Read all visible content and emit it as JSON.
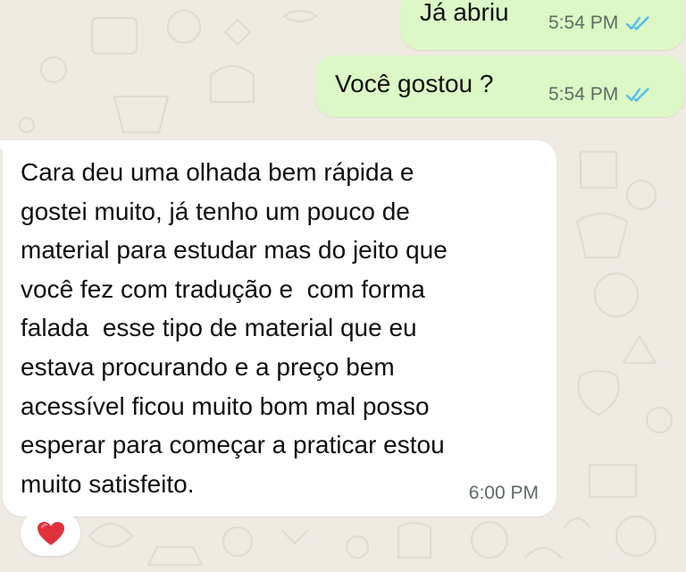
{
  "messages": [
    {
      "direction": "outgoing",
      "text": "Já abriu",
      "time": "5:54 PM",
      "status": "read"
    },
    {
      "direction": "outgoing",
      "text": "Você gostou ?",
      "time": "5:54 PM",
      "status": "read"
    },
    {
      "direction": "incoming",
      "lines": [
        "Cara deu uma olhada bem rápida e",
        "gostei muito, já tenho um pouco de",
        "material para estudar mas do jeito que",
        "você fez com tradução e  com forma",
        "falada  esse tipo de material que eu",
        "estava procurando e a preço bem",
        "acessível ficou muito bom mal posso",
        "esperar para começar a praticar estou",
        "muito satisfeito."
      ],
      "time": "6:00 PM",
      "reaction": "heart-emoji"
    }
  ],
  "colors": {
    "background": "#efeae2",
    "outgoing_bubble": "#dcf8c6",
    "incoming_bubble": "#ffffff",
    "read_ticks": "#53bdeb",
    "reaction_heart": "#e0313b"
  },
  "icons": {
    "read_receipt": "double-check-icon",
    "reaction": "heart-icon"
  }
}
